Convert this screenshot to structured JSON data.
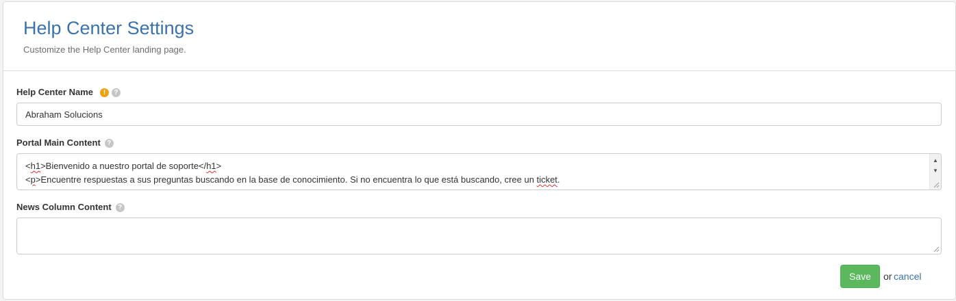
{
  "header": {
    "title": "Help Center Settings",
    "subtitle": "Customize the Help Center landing page."
  },
  "fields": {
    "help_center_name": {
      "label": "Help Center Name",
      "value": "Abraham Solucions",
      "warning_icon": "exclamation-circle-icon",
      "help_icon": "question-circle-icon"
    },
    "portal_main_content": {
      "label": "Portal Main Content",
      "help_icon": "question-circle-icon",
      "line1_open": "<",
      "line1_tag": "h1",
      "line1_mid": ">Bienvenido a nuestro portal de soporte</",
      "line1_tag_close": "h1",
      "line1_end": ">",
      "line2_open": "<",
      "line2_tag": "p",
      "line2_mid": ">Encuentre respuestas a sus preguntas buscando en la base de conocimiento. Si no encuentra lo que está buscando, cree un ",
      "line2_word": "ticket",
      "line2_end": "."
    },
    "news_column_content": {
      "label": "News Column Content",
      "value": "",
      "help_icon": "question-circle-icon"
    }
  },
  "actions": {
    "save_label": "Save",
    "or_text": "or",
    "cancel_label": "cancel"
  },
  "colors": {
    "title": "#3a72ad",
    "save_button": "#5cb85c",
    "link": "#3a72ad",
    "warning": "#f0a10f"
  }
}
